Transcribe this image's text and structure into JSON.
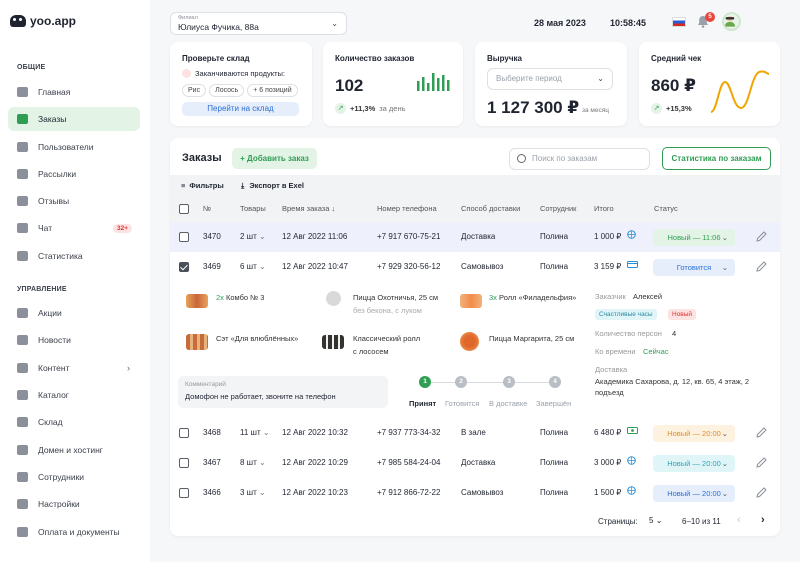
{
  "logo": "yoo.app",
  "sidebar": {
    "sections": [
      "ОБЩИЕ",
      "УПРАВЛЕНИЕ"
    ],
    "items": [
      {
        "label": "Главная",
        "icon": "home-icon"
      },
      {
        "label": "Заказы",
        "icon": "bag-icon",
        "active": true
      },
      {
        "label": "Пользователи",
        "icon": "user-icon"
      },
      {
        "label": "Рассылки",
        "icon": "mail-icon"
      },
      {
        "label": "Отзывы",
        "icon": "star-icon"
      },
      {
        "label": "Чат",
        "icon": "chat-icon",
        "badge": "32+"
      },
      {
        "label": "Статистика",
        "icon": "chart-icon"
      },
      {
        "label": "Акции",
        "icon": "doc-icon"
      },
      {
        "label": "Новости",
        "icon": "doc-icon"
      },
      {
        "label": "Контент",
        "icon": "user-icon"
      },
      {
        "label": "Каталог",
        "icon": "chart-icon"
      },
      {
        "label": "Склад",
        "icon": "chart-icon"
      },
      {
        "label": "Домен и хостинг",
        "icon": "user-icon"
      },
      {
        "label": "Сотрудники",
        "icon": "user-icon"
      },
      {
        "label": "Настройки",
        "icon": "doc-icon"
      },
      {
        "label": "Оплата и документы",
        "icon": "user-icon"
      }
    ]
  },
  "topbar": {
    "branch_label": "Филиал",
    "branch_value": "Юлиуса Фучика, 88а",
    "date": "28 мая 2023",
    "time": "10:58:45",
    "notifications": "5"
  },
  "stock": {
    "title": "Проверьте склад",
    "warning": "Заканчиваются продукты:",
    "chips": [
      "Рис",
      "Лосось",
      "+ 6 позиций"
    ],
    "button": "Перейти на склад"
  },
  "orders_count": {
    "title": "Количество заказов",
    "value": "102",
    "delta": "+11,3%",
    "delta_suffix": "за день",
    "bars": [
      0.55,
      0.8,
      0.45,
      1.0,
      0.7,
      0.9,
      0.6
    ]
  },
  "revenue": {
    "title": "Выручка",
    "period_placeholder": "Выберите период",
    "value": "1 127 300 ₽",
    "suffix": "за месяц"
  },
  "avg_check": {
    "title": "Средний чек",
    "value": "860 ₽",
    "delta": "+15,3%"
  },
  "orders": {
    "title": "Заказы",
    "add_button": "+ Добавить заказ",
    "search_placeholder": "Поиск по заказам",
    "stats_button": "Статистика по заказам",
    "filters": "Фильтры",
    "export": "Экспорт в Exel",
    "columns": [
      "№",
      "Товары",
      "Время заказа ↓",
      "Номер телефона",
      "Способ доставки",
      "Сотрудник",
      "Итого",
      "Статус"
    ],
    "rows": [
      {
        "id": "3470",
        "items": "2 шт",
        "time": "12 Авг 2022 11:06",
        "phone": "+7 917 670-75-21",
        "delivery": "Доставка",
        "employee": "Полина",
        "total": "1 000 ₽",
        "pay": "globe",
        "status": "Новый — 11:06",
        "status_color": "#2f9e54",
        "status_bg": "#e3f3e6",
        "checked": false
      },
      {
        "id": "3469",
        "items": "6 шт",
        "time": "12 Авг 2022 10:47",
        "phone": "+7 929 320-56-12",
        "delivery": "Самовывоз",
        "employee": "Полина",
        "total": "3 159 ₽",
        "pay": "card",
        "status": "Готовится",
        "status_color": "#2b6fd6",
        "status_bg": "#e6eefb",
        "checked": true
      },
      {
        "id": "3468",
        "items": "11 шт",
        "time": "12 Авг 2022 10:32",
        "phone": "+7 937 773-34-32",
        "delivery": "В зале",
        "employee": "Полина",
        "total": "6 480 ₽",
        "pay": "cash",
        "status": "Новый — 20:00",
        "status_color": "#e0922b",
        "status_bg": "#fdf1df",
        "checked": false
      },
      {
        "id": "3467",
        "items": "8 шт",
        "time": "12 Авг 2022 10:29",
        "phone": "+7 985 584-24-04",
        "delivery": "Доставка",
        "employee": "Полина",
        "total": "3 000 ₽",
        "pay": "globe",
        "status": "Новый — 20:00",
        "status_color": "#2aa7b8",
        "status_bg": "#e0f5f7",
        "checked": false
      },
      {
        "id": "3466",
        "items": "3 шт",
        "time": "12 Авг 2022 10:23",
        "phone": "+7 912 866-72-22",
        "delivery": "Самовывоз",
        "employee": "Полина",
        "total": "1 500 ₽",
        "pay": "globe",
        "status": "Новый — 20:00",
        "status_color": "#2b6fd6",
        "status_bg": "#e6eefb",
        "checked": false
      }
    ],
    "detail": {
      "products": [
        {
          "qty": "2x",
          "name": "Комбо № 3",
          "sub": ""
        },
        {
          "qty": "",
          "name": "Пицца Охотничья, 25 см",
          "sub": "без бекона, с луком"
        },
        {
          "qty": "3x",
          "name": "Ролл «Филадельфия»",
          "sub": ""
        },
        {
          "qty": "",
          "name": "Сэт «Для влюблённых»",
          "sub": ""
        },
        {
          "qty": "",
          "name": "Классический ролл",
          "sub": "с лососем"
        },
        {
          "qty": "",
          "name": "Пицца Маргарита, 25 см",
          "sub": ""
        }
      ],
      "customer_label": "Заказчик",
      "customer": "Алексей",
      "tag1": "Счастливые часы",
      "tag2": "Новый",
      "persons_label": "Количество персон",
      "persons": "4",
      "when_label": "Ко времени",
      "when": "Сейчас",
      "delivery_label": "Доставка",
      "address": "Академика Сахарова, д. 12, кв. 65, 4 этаж, 2 подъезд",
      "comment_label": "Комментарий",
      "comment": "Домофон не работает, звоните на телефон",
      "steps": [
        "Принят",
        "Готовится",
        "В доставке",
        "Завершён"
      ]
    },
    "pagination": {
      "label": "Страницы:",
      "per_page": "5",
      "range": "6–10 из 11"
    }
  }
}
